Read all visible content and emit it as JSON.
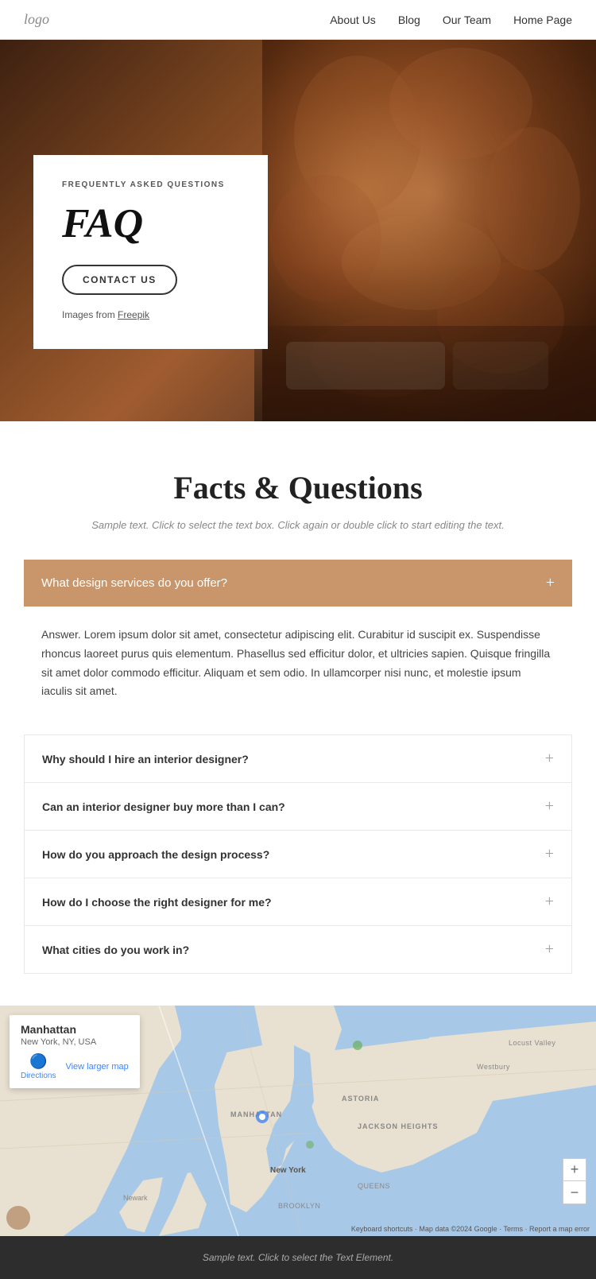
{
  "navbar": {
    "logo": "logo",
    "links": [
      "About Us",
      "Blog",
      "Our Team",
      "Home Page"
    ]
  },
  "hero": {
    "subtitle": "FREQUENTLY ASKED QUESTIONS",
    "title": "FAQ",
    "button_label": "CONTACT US",
    "image_credit_prefix": "Images from ",
    "image_credit_link": "Freepik"
  },
  "faq_section": {
    "title": "Facts & Questions",
    "subtitle": "Sample text. Click to select the text box. Click again or double click to start editing the text.",
    "active_question": "What design services do you offer?",
    "active_answer": "Answer. Lorem ipsum dolor sit amet, consectetur adipiscing elit. Curabitur id suscipit ex. Suspendisse rhoncus laoreet purus quis elementum. Phasellus sed efficitur dolor, et ultricies sapien. Quisque fringilla sit amet dolor commodo efficitur. Aliquam et sem odio. In ullamcorper nisi nunc, et molestie ipsum iaculis sit amet.",
    "questions": [
      "Why should I hire an interior designer?",
      "Can an interior designer buy more than I can?",
      "How do you approach the design process?",
      "How do I choose the right designer for me?",
      "What cities do you work in?"
    ]
  },
  "map": {
    "popup_title": "Manhattan",
    "popup_subtitle": "New York, NY, USA",
    "directions_label": "Directions",
    "larger_map_label": "View larger map",
    "zoom_in": "+",
    "zoom_out": "−"
  },
  "footer": {
    "text": "Sample text. Click to select the Text Element."
  }
}
